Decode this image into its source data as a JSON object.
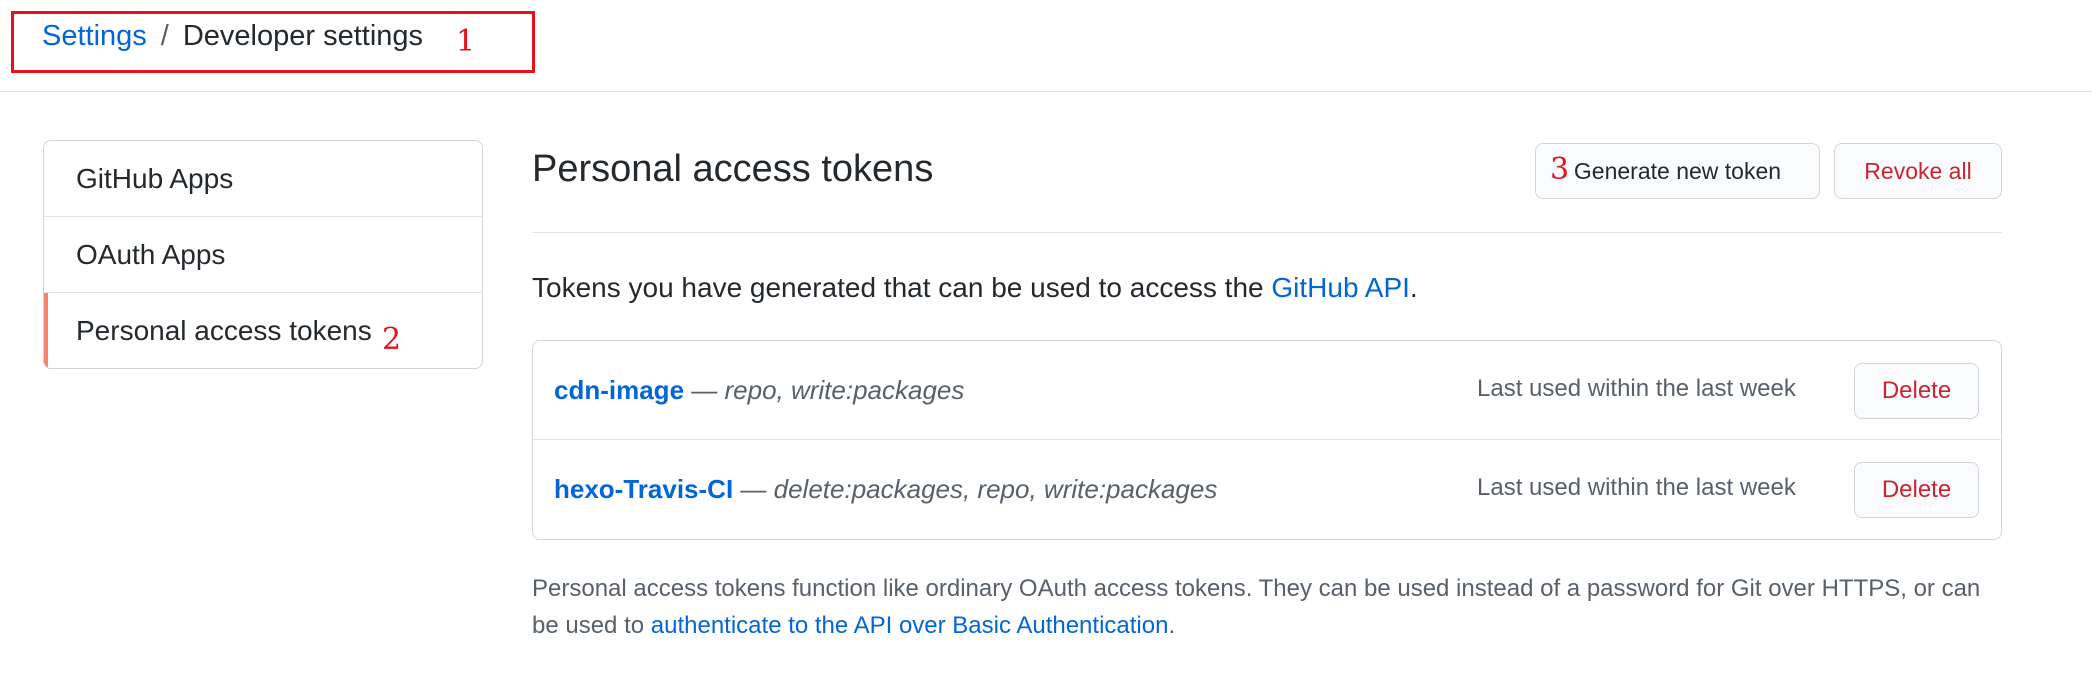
{
  "breadcrumb": {
    "parent": "Settings",
    "separator": "/",
    "current": "Developer settings"
  },
  "annotations": [
    "1",
    "2",
    "3"
  ],
  "sidebar": {
    "items": [
      {
        "label": "GitHub Apps"
      },
      {
        "label": "OAuth Apps"
      },
      {
        "label": "Personal access tokens",
        "selected": true
      }
    ]
  },
  "main": {
    "title": "Personal access tokens",
    "generate_label": "Generate new token",
    "revoke_label": "Revoke all",
    "intro_prefix": "Tokens you have generated that can be used to access the ",
    "intro_link": "GitHub API",
    "intro_suffix": ".",
    "tokens": [
      {
        "name": "cdn-image",
        "dash": " — ",
        "scopes": "repo, write:packages",
        "last_used": "Last used within the last week",
        "delete_label": "Delete"
      },
      {
        "name": "hexo-Travis-CI",
        "dash": " — ",
        "scopes": "delete:packages, repo, write:packages",
        "last_used": "Last used within the last week",
        "delete_label": "Delete"
      }
    ],
    "footnote_prefix": "Personal access tokens function like ordinary OAuth access tokens. They can be used instead of a password for Git over HTTPS, or can be used to ",
    "footnote_link": "authenticate to the API over Basic Authentication",
    "footnote_suffix": "."
  },
  "colors": {
    "link": "#0366d6",
    "danger": "#cb2431",
    "selected_indicator": "#f9826c",
    "annotation": "#e8101a"
  }
}
